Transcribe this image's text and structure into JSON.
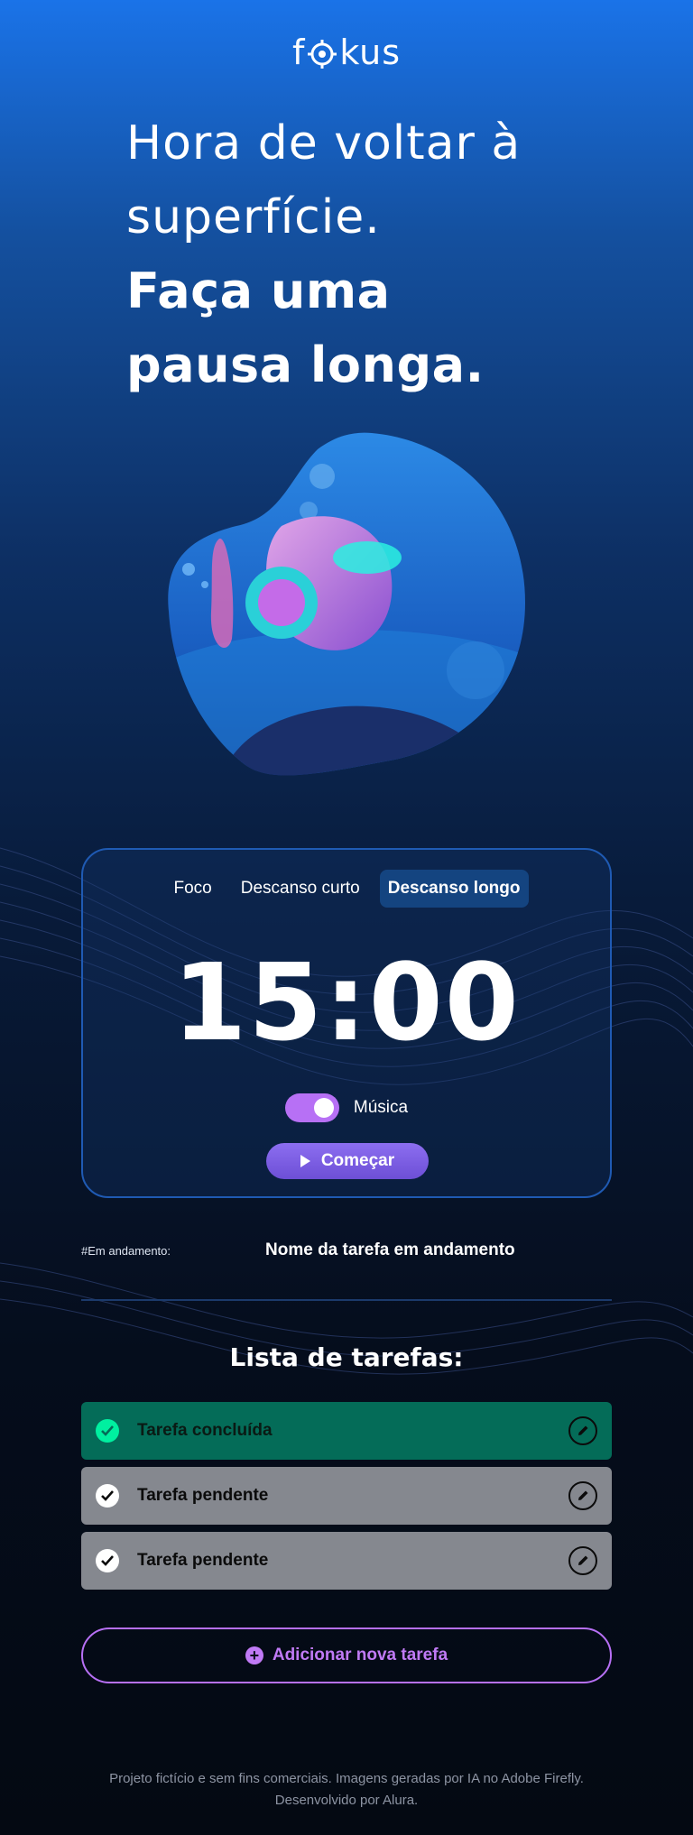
{
  "logo": {
    "text_before": "f",
    "text_after": "kus"
  },
  "headline": {
    "line1": "Hora de voltar à",
    "line2": "superfície.",
    "line3": "Faça uma",
    "line4": "pausa longa."
  },
  "timer": {
    "tabs": [
      {
        "label": "Foco",
        "active": false
      },
      {
        "label": "Descanso curto",
        "active": false
      },
      {
        "label": "Descanso longo",
        "active": true
      }
    ],
    "time": "15:00",
    "music_label": "Música",
    "music_on": true,
    "start_label": "Começar"
  },
  "in_progress": {
    "label": "#Em andamento:",
    "task": "Nome da tarefa em andamento"
  },
  "task_list": {
    "title": "Lista de tarefas:",
    "items": [
      {
        "label": "Tarefa concluída",
        "status": "done"
      },
      {
        "label": "Tarefa pendente",
        "status": "pending"
      },
      {
        "label": "Tarefa pendente",
        "status": "pending"
      }
    ],
    "add_label": "Adicionar nova tarefa"
  },
  "footer": {
    "line1": "Projeto fictício e sem fins comerciais. Imagens geradas por IA no Adobe Firefly.",
    "line2": "Desenvolvido por Alura."
  },
  "colors": {
    "accent_purple": "#b770f5",
    "done_green": "#046c58",
    "pending_gray": "#85888f",
    "check_green": "#00f0a0"
  },
  "icons": [
    "target-icon",
    "play-icon",
    "check-icon",
    "pencil-icon",
    "plus-circle-icon"
  ]
}
